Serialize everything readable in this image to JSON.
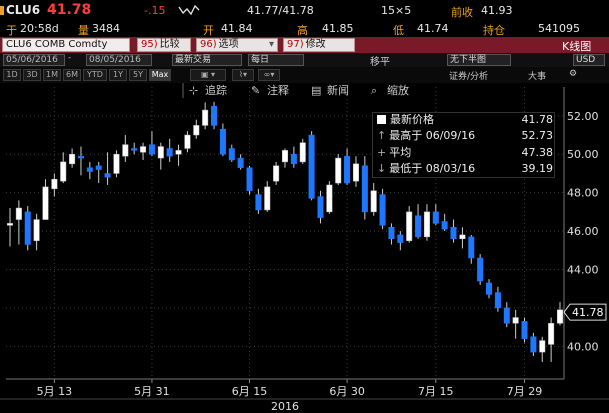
{
  "header": {
    "ticker": "CLU6",
    "last": "41.78",
    "change": "-.15",
    "bid_ask": "41.77/41.78",
    "size": "15×5",
    "prev_close_label": "前收",
    "prev_close": "41.93",
    "time_label": "于",
    "time": "20:58d",
    "vol_label": "量",
    "volume": "3484",
    "open_label": "开",
    "open": "41.84",
    "high_label": "高",
    "high": "41.85",
    "low_label": "低",
    "low": "41.74",
    "oi_label": "持仓",
    "open_interest": "541095"
  },
  "menu": {
    "security": "CLU6 COMB Comdty",
    "items": [
      {
        "num": "95)",
        "label": "比较"
      },
      {
        "num": "96)",
        "label": "选项"
      },
      {
        "num": "97)",
        "label": "修改"
      }
    ],
    "right_label": "K线图"
  },
  "toolbar2": {
    "start_date": "05/06/2016",
    "end_date": "08/05/2016",
    "mode": "最新交易",
    "period": "每日",
    "smooth_label": "移平",
    "range_label": "无下半图",
    "event_label": "证券/分析",
    "zoom_label": "大事",
    "currency": "USD"
  },
  "periods": [
    "1D",
    "3D",
    "1M",
    "6M",
    "YTD",
    "1Y",
    "5Y",
    "Max"
  ],
  "chart_toolbar": [
    "追踪",
    "注释",
    "新闻",
    "缩放"
  ],
  "legend": {
    "last_label": "最新价格",
    "last_value": "41.78",
    "high_label": "最高于 06/09/16",
    "high_value": "52.73",
    "avg_label": "平均",
    "avg_value": "47.38",
    "low_label": "最低于 08/03/16",
    "low_value": "39.19"
  },
  "chart_data": {
    "type": "candlestick",
    "xlabel": "2016",
    "x_tick_labels": [
      "5月 13",
      "5月 31",
      "6月 15",
      "6月 30",
      "7月 15",
      "7月 29"
    ],
    "y_ticks": [
      40.0,
      42.0,
      44.0,
      46.0,
      48.0,
      50.0,
      52.0
    ],
    "ylim": [
      38.3,
      53.5
    ],
    "last_price_tag": "41.78",
    "colors": {
      "up": "#ffffff",
      "down": "#1e78ff",
      "wick": "#cfcfcf",
      "grid": "#3a3a3a"
    },
    "candles": [
      {
        "d": "05/06",
        "o": 46.3,
        "h": 47.2,
        "l": 45.2,
        "c": 46.4
      },
      {
        "d": "05/09",
        "o": 46.6,
        "h": 47.6,
        "l": 45.3,
        "c": 47.2
      },
      {
        "d": "05/10",
        "o": 47.0,
        "h": 47.3,
        "l": 45.0,
        "c": 45.3
      },
      {
        "d": "05/11",
        "o": 45.5,
        "h": 46.9,
        "l": 45.0,
        "c": 46.6
      },
      {
        "d": "05/12",
        "o": 46.6,
        "h": 48.7,
        "l": 46.6,
        "c": 48.3
      },
      {
        "d": "05/13",
        "o": 48.2,
        "h": 49.0,
        "l": 47.8,
        "c": 48.7
      },
      {
        "d": "05/16",
        "o": 48.6,
        "h": 50.1,
        "l": 48.5,
        "c": 49.6
      },
      {
        "d": "05/17",
        "o": 49.5,
        "h": 50.3,
        "l": 49.3,
        "c": 50.0
      },
      {
        "d": "05/18",
        "o": 49.9,
        "h": 50.4,
        "l": 48.9,
        "c": 49.8
      },
      {
        "d": "05/19",
        "o": 49.3,
        "h": 49.6,
        "l": 48.7,
        "c": 49.1
      },
      {
        "d": "05/20",
        "o": 49.4,
        "h": 49.6,
        "l": 48.5,
        "c": 49.2
      },
      {
        "d": "05/23",
        "o": 49.0,
        "h": 50.1,
        "l": 48.4,
        "c": 48.8
      },
      {
        "d": "05/24",
        "o": 49.0,
        "h": 50.2,
        "l": 48.8,
        "c": 50.0
      },
      {
        "d": "05/25",
        "o": 49.9,
        "h": 51.0,
        "l": 49.6,
        "c": 50.5
      },
      {
        "d": "05/26",
        "o": 50.3,
        "h": 50.6,
        "l": 50.0,
        "c": 50.2
      },
      {
        "d": "05/27",
        "o": 50.1,
        "h": 50.6,
        "l": 49.7,
        "c": 50.4
      },
      {
        "d": "05/31",
        "o": 50.5,
        "h": 51.2,
        "l": 49.9,
        "c": 50.0
      },
      {
        "d": "06/01",
        "o": 49.8,
        "h": 50.6,
        "l": 49.2,
        "c": 50.4
      },
      {
        "d": "06/02",
        "o": 50.3,
        "h": 50.8,
        "l": 49.6,
        "c": 49.9
      },
      {
        "d": "06/03",
        "o": 50.0,
        "h": 50.5,
        "l": 49.4,
        "c": 50.2
      },
      {
        "d": "06/06",
        "o": 50.3,
        "h": 51.2,
        "l": 50.1,
        "c": 51.0
      },
      {
        "d": "06/07",
        "o": 51.0,
        "h": 51.8,
        "l": 50.8,
        "c": 51.5
      },
      {
        "d": "06/08",
        "o": 51.5,
        "h": 52.7,
        "l": 51.3,
        "c": 52.3
      },
      {
        "d": "06/09",
        "o": 52.5,
        "h": 52.73,
        "l": 51.3,
        "c": 51.5
      },
      {
        "d": "06/10",
        "o": 51.3,
        "h": 51.6,
        "l": 49.9,
        "c": 50.0
      },
      {
        "d": "06/13",
        "o": 50.3,
        "h": 50.5,
        "l": 49.6,
        "c": 49.7
      },
      {
        "d": "06/14",
        "o": 49.8,
        "h": 50.0,
        "l": 49.2,
        "c": 49.3
      },
      {
        "d": "06/15",
        "o": 49.3,
        "h": 49.4,
        "l": 47.9,
        "c": 48.1
      },
      {
        "d": "06/16",
        "o": 47.9,
        "h": 48.2,
        "l": 46.9,
        "c": 47.1
      },
      {
        "d": "06/17",
        "o": 47.1,
        "h": 48.6,
        "l": 47.0,
        "c": 48.3
      },
      {
        "d": "06/20",
        "o": 48.6,
        "h": 49.6,
        "l": 48.4,
        "c": 49.4
      },
      {
        "d": "06/21",
        "o": 49.6,
        "h": 50.3,
        "l": 49.3,
        "c": 50.2
      },
      {
        "d": "06/22",
        "o": 50.0,
        "h": 50.4,
        "l": 49.3,
        "c": 49.5
      },
      {
        "d": "06/23",
        "o": 49.6,
        "h": 50.8,
        "l": 49.5,
        "c": 50.6
      },
      {
        "d": "06/24",
        "o": 51.0,
        "h": 51.2,
        "l": 47.6,
        "c": 47.7
      },
      {
        "d": "06/27",
        "o": 47.8,
        "h": 48.1,
        "l": 46.4,
        "c": 46.7
      },
      {
        "d": "06/28",
        "o": 47.0,
        "h": 48.6,
        "l": 46.9,
        "c": 48.4
      },
      {
        "d": "06/29",
        "o": 48.5,
        "h": 50.0,
        "l": 48.4,
        "c": 49.8
      },
      {
        "d": "06/30",
        "o": 49.9,
        "h": 50.3,
        "l": 48.4,
        "c": 48.5
      },
      {
        "d": "07/01",
        "o": 48.6,
        "h": 49.9,
        "l": 48.3,
        "c": 49.5
      },
      {
        "d": "07/05",
        "o": 49.4,
        "h": 49.9,
        "l": 46.6,
        "c": 47.0
      },
      {
        "d": "07/06",
        "o": 47.0,
        "h": 48.5,
        "l": 46.8,
        "c": 48.1
      },
      {
        "d": "07/07",
        "o": 47.9,
        "h": 48.2,
        "l": 46.1,
        "c": 46.3
      },
      {
        "d": "07/08",
        "o": 46.2,
        "h": 46.4,
        "l": 45.3,
        "c": 45.6
      },
      {
        "d": "07/11",
        "o": 45.8,
        "h": 46.0,
        "l": 45.0,
        "c": 45.4
      },
      {
        "d": "07/12",
        "o": 45.5,
        "h": 47.3,
        "l": 45.4,
        "c": 47.0
      },
      {
        "d": "07/13",
        "o": 46.8,
        "h": 47.4,
        "l": 45.6,
        "c": 45.7
      },
      {
        "d": "07/14",
        "o": 45.7,
        "h": 47.4,
        "l": 45.5,
        "c": 47.0
      },
      {
        "d": "07/15",
        "o": 47.0,
        "h": 47.4,
        "l": 46.3,
        "c": 46.4
      },
      {
        "d": "07/18",
        "o": 46.5,
        "h": 46.9,
        "l": 46.0,
        "c": 46.1
      },
      {
        "d": "07/19",
        "o": 46.2,
        "h": 46.6,
        "l": 45.4,
        "c": 45.6
      },
      {
        "d": "07/20",
        "o": 45.6,
        "h": 46.2,
        "l": 45.1,
        "c": 45.8
      },
      {
        "d": "07/21",
        "o": 45.7,
        "h": 45.8,
        "l": 44.3,
        "c": 44.6
      },
      {
        "d": "07/22",
        "o": 44.6,
        "h": 44.8,
        "l": 43.2,
        "c": 43.4
      },
      {
        "d": "07/25",
        "o": 43.3,
        "h": 43.5,
        "l": 42.5,
        "c": 42.7
      },
      {
        "d": "07/26",
        "o": 42.8,
        "h": 43.1,
        "l": 41.8,
        "c": 42.0
      },
      {
        "d": "07/27",
        "o": 42.0,
        "h": 42.3,
        "l": 41.0,
        "c": 41.2
      },
      {
        "d": "07/28",
        "o": 41.2,
        "h": 41.9,
        "l": 40.4,
        "c": 41.5
      },
      {
        "d": "07/29",
        "o": 41.3,
        "h": 41.5,
        "l": 40.2,
        "c": 40.4
      },
      {
        "d": "08/01",
        "o": 40.5,
        "h": 40.7,
        "l": 39.5,
        "c": 39.7
      },
      {
        "d": "08/02",
        "o": 39.7,
        "h": 40.5,
        "l": 39.19,
        "c": 40.3
      },
      {
        "d": "08/03",
        "o": 40.1,
        "h": 41.5,
        "l": 39.19,
        "c": 41.2
      },
      {
        "d": "08/04",
        "o": 41.2,
        "h": 42.3,
        "l": 41.1,
        "c": 41.9
      }
    ]
  }
}
